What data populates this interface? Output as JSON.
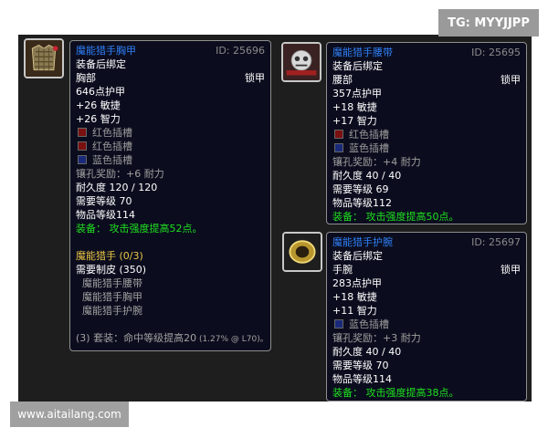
{
  "watermark_top": "TG: MYYJJPP",
  "watermark_bottom": "www.aitailang.com",
  "colors": {
    "item_name": "#2f7ff5",
    "equip_green": "#1ee01e",
    "set_gold": "#e9c446",
    "grey": "#a0a0a0",
    "tooltip_bg": "#0b0d1e"
  },
  "chest": {
    "icon": "mail-chest-icon",
    "name": "魔能猎手胸甲",
    "id": "ID: 25696",
    "bind": "装备后绑定",
    "slot": "胸部",
    "type": "锁甲",
    "armor": "646点护甲",
    "stat1": "+26 敏捷",
    "stat2": "+26 智力",
    "socket1": "红色插槽",
    "socket2": "红色插槽",
    "socket3": "蓝色插槽",
    "socket_bonus": "镶孔奖励：+6 耐力",
    "durability": "耐久度 120 / 120",
    "req_level": "需要等级 70",
    "item_level": "物品等级114",
    "equip": "装备：  攻击强度提高52点。",
    "set_name": "魔能猎手  (0/3)",
    "set_req": "需要制皮 (350)",
    "set_items": [
      "魔能猎手腰带",
      "魔能猎手胸甲",
      "魔能猎手护腕"
    ],
    "set_bonus_main": "(3) 套装：命中等级提高20",
    "set_bonus_small": " (1.27% @ L70)。"
  },
  "belt": {
    "icon": "mail-belt-icon",
    "name": "魔能猎手腰带",
    "id": "ID: 25695",
    "bind": "装备后绑定",
    "slot": "腰部",
    "type": "锁甲",
    "armor": "357点护甲",
    "stat1": "+18 敏捷",
    "stat2": "+17 智力",
    "socket1": "红色插槽",
    "socket2": "蓝色插槽",
    "socket_bonus": "镶孔奖励：+4 耐力",
    "durability": "耐久度 40 / 40",
    "req_level": "需要等级 69",
    "item_level": "物品等级112",
    "equip": "装备：  攻击强度提高50点。"
  },
  "bracer": {
    "icon": "mail-bracer-icon",
    "name": "魔能猎手护腕",
    "id": "ID: 25697",
    "bind": "装备后绑定",
    "slot": "手腕",
    "type": "锁甲",
    "armor": "283点护甲",
    "stat1": "+18 敏捷",
    "stat2": "+11 智力",
    "socket1": "蓝色插槽",
    "socket_bonus": "镶孔奖励：+3 耐力",
    "durability": "耐久度 40 / 40",
    "req_level": "需要等级 70",
    "item_level": "物品等级114",
    "equip": "装备：  攻击强度提高38点。"
  }
}
